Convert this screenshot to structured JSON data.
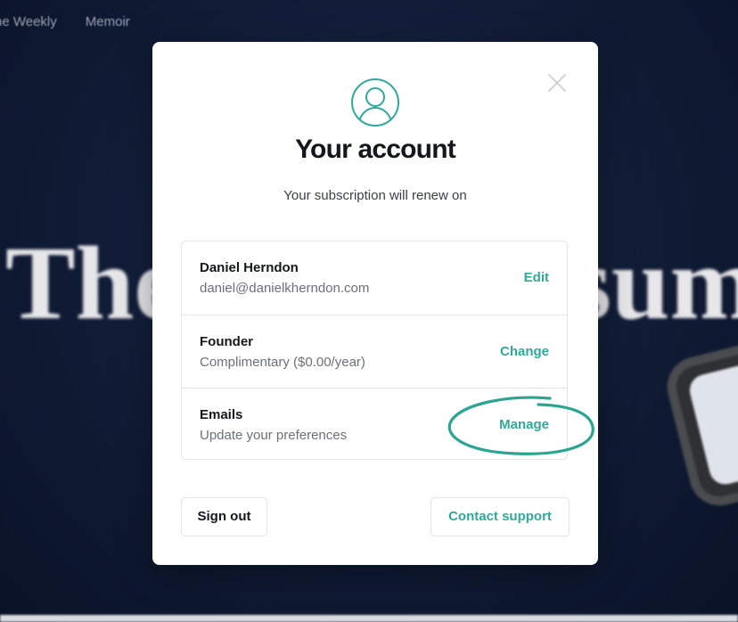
{
  "background": {
    "nav_items": [
      "he Weekly",
      "Memoir"
    ],
    "headline_left": "The",
    "headline_right": "sum"
  },
  "modal": {
    "title": "Your account",
    "subtitle": "Your subscription will renew on",
    "icons": {
      "avatar": "user-circle-icon",
      "close": "close-icon"
    },
    "accent_color": "#30a99a",
    "rows": [
      {
        "title": "Daniel Herndon",
        "subtitle": "daniel@danielkherndon.com",
        "action": "Edit"
      },
      {
        "title": "Founder",
        "subtitle": "Complimentary ($0.00/year)",
        "action": "Change"
      },
      {
        "title": "Emails",
        "subtitle": "Update your preferences",
        "action": "Manage"
      }
    ],
    "sign_out_label": "Sign out",
    "contact_support_label": "Contact support"
  }
}
